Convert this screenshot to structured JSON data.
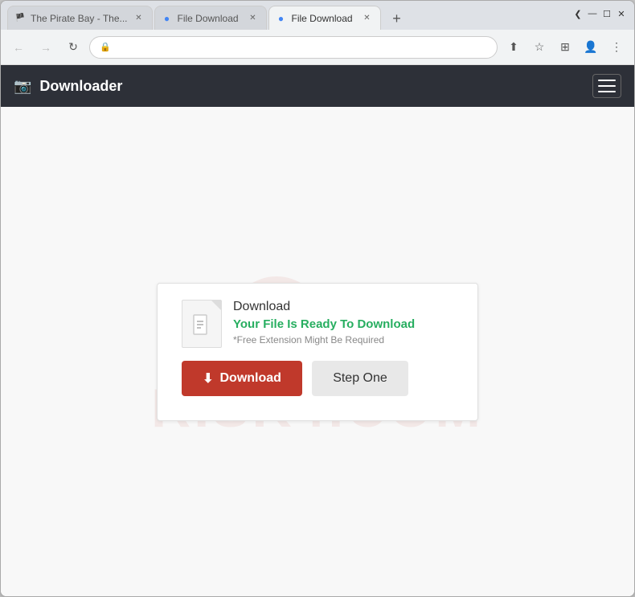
{
  "browser": {
    "tabs": [
      {
        "id": "tab1",
        "favicon": "🏴",
        "title": "The Pirate Bay - The...",
        "active": false,
        "closable": true
      },
      {
        "id": "tab2",
        "favicon": "🔵",
        "title": "File Download",
        "active": false,
        "closable": true
      },
      {
        "id": "tab3",
        "favicon": "🔵",
        "title": "File Download",
        "active": true,
        "closable": true
      }
    ],
    "new_tab_label": "+",
    "window_controls": {
      "minimize": "—",
      "maximize": "☐",
      "close": "✕"
    },
    "chevron": "❮",
    "nav": {
      "back": "←",
      "forward": "→",
      "refresh": "↻"
    },
    "address": "",
    "toolbar_icons": [
      "⬆",
      "☆",
      "⊞",
      "👤",
      "⋮"
    ]
  },
  "navbar": {
    "brand_icon": "📷",
    "brand_title": "Downloader",
    "hamburger_label": "☰"
  },
  "download_card": {
    "file_title": "Download",
    "file_ready": "Your File Is Ready To Download",
    "file_note": "*Free Extension Might Be Required",
    "download_btn": "Download",
    "step_btn": "Step One",
    "download_icon": "⬇"
  },
  "watermark": {
    "top_text": "risk",
    "bottom_text": "risk4.com"
  }
}
